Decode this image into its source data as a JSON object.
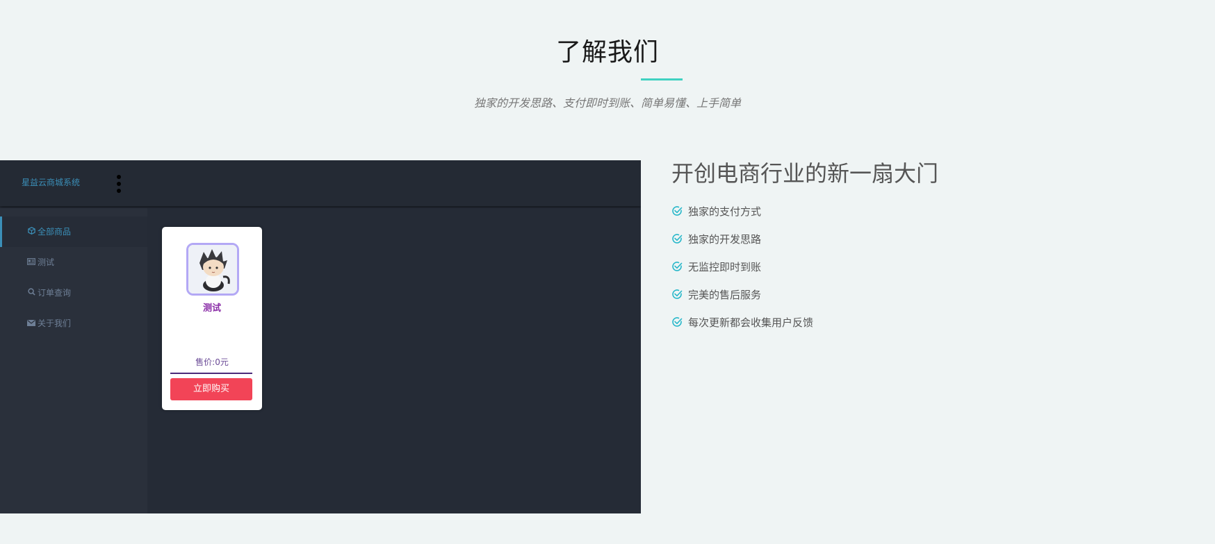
{
  "section": {
    "title": "了解我们",
    "subtitle": "独家的开发思路、支付即时到账、简单易懂、上手简单"
  },
  "app": {
    "brand": "星益云商城系统",
    "nav": [
      {
        "label": "全部商品",
        "icon": "cube-icon",
        "active": true
      },
      {
        "label": "测试",
        "icon": "id-card-icon",
        "active": false
      },
      {
        "label": "订单查询",
        "icon": "search-icon",
        "active": false
      },
      {
        "label": "关于我们",
        "icon": "envelope-icon",
        "active": false
      }
    ],
    "product": {
      "name": "测试",
      "price": "售价:0元",
      "buy_label": "立即购买"
    }
  },
  "features": {
    "heading": "开创电商行业的新一扇大门",
    "items": [
      "独家的支付方式",
      "独家的开发思路",
      "无监控即时到账",
      "完美的售后服务",
      "每次更新都会收集用户反馈"
    ],
    "icon": "check-circle-icon"
  },
  "colors": {
    "accent": "#3fd1c1",
    "app_bg": "#252b36",
    "brand_blue": "#3b8fb8",
    "buy_red": "#f24457",
    "product_purple": "#8b2ea8"
  }
}
